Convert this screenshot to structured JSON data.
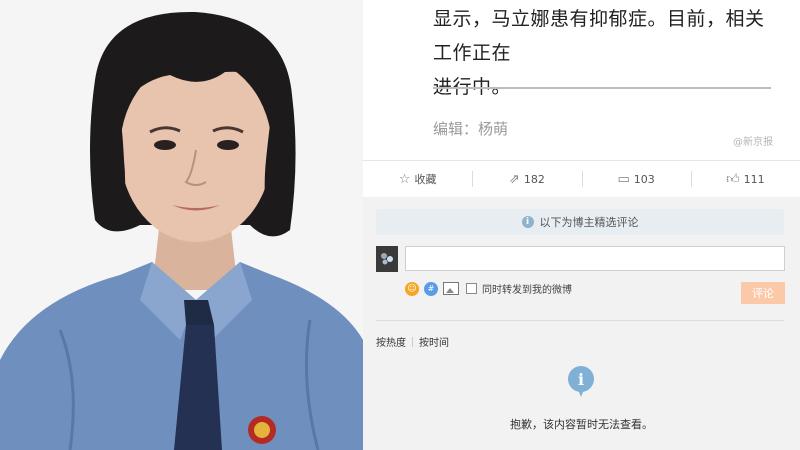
{
  "article": {
    "lines": [
      "显示，马立娜患有抑郁症。目前，相关工作正在",
      "进行中。"
    ],
    "editor": "编辑：杨萌",
    "watermark": "@新京报"
  },
  "actions": {
    "favorite": {
      "icon": "star-icon",
      "label": "收藏"
    },
    "repost": {
      "icon": "share-icon",
      "count": "182"
    },
    "comment": {
      "icon": "comment-icon",
      "count": "103"
    },
    "like": {
      "icon": "thumbs-up-icon",
      "count": "111"
    }
  },
  "comments": {
    "notice": "以下为博主精选评论",
    "input_placeholder": "",
    "repost_checkbox_label": "同时转发到我的微博",
    "submit_label": "评论",
    "sort_hot": "按热度",
    "sort_time": "按时间",
    "empty_message": "抱歉，该内容暂时无法查看。"
  },
  "colors": {
    "submit_bg": "#fcc9a8",
    "notice_bg": "#e8edf2",
    "info_icon": "#7fb0d6"
  }
}
